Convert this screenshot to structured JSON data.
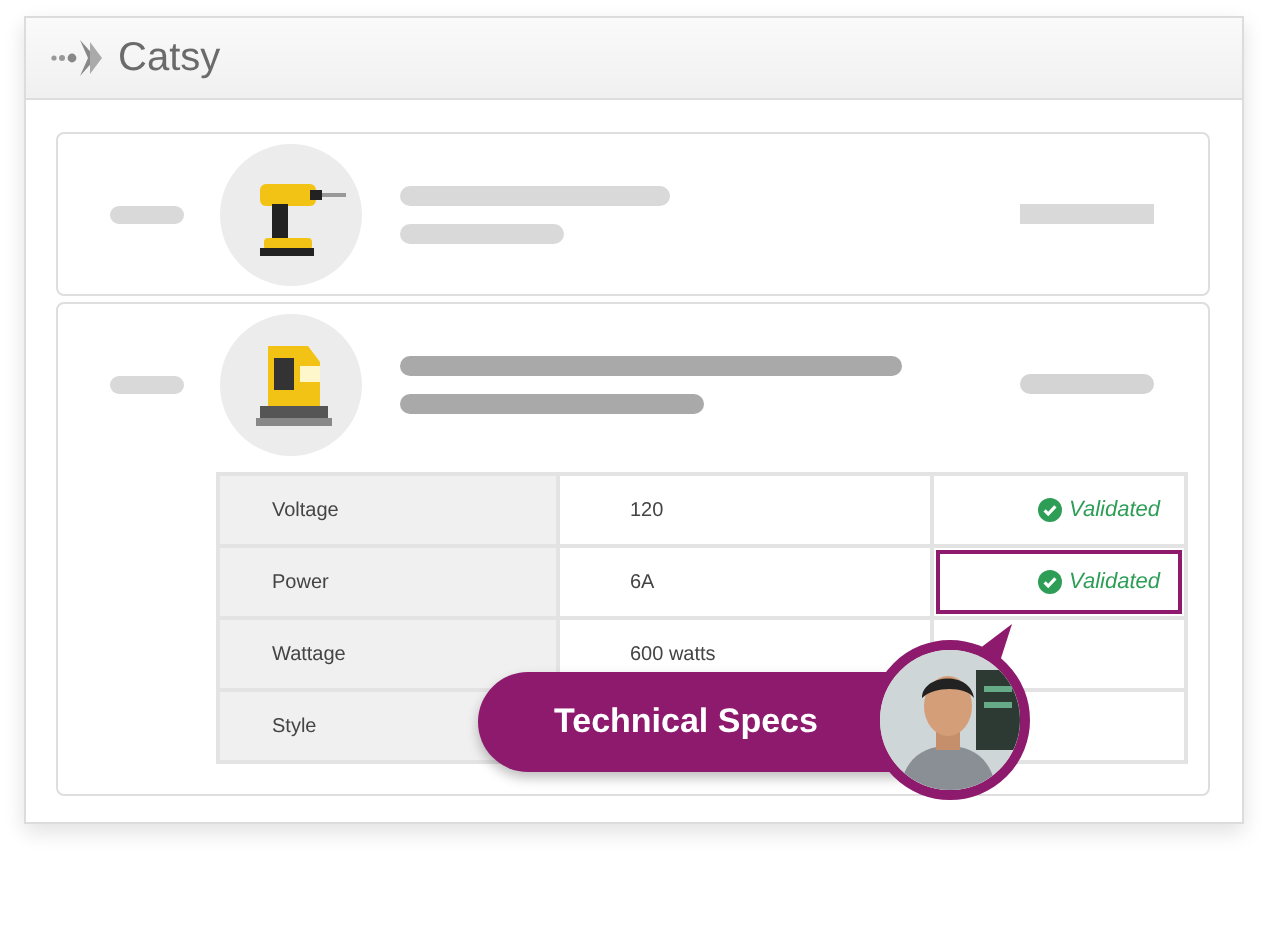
{
  "window": {
    "title": "Catsy"
  },
  "products": [
    {
      "expanded": false,
      "kind": "drill"
    },
    {
      "expanded": true,
      "kind": "jigsaw",
      "specs": [
        {
          "label": "Voltage",
          "value": "120",
          "status": "Validated",
          "highlighted": false
        },
        {
          "label": "Power",
          "value": "6A",
          "status": "Validated",
          "highlighted": true
        },
        {
          "label": "Wattage",
          "value": "600 watts"
        },
        {
          "label": "Style"
        }
      ]
    }
  ],
  "callout": {
    "label": "Technical Specs"
  }
}
